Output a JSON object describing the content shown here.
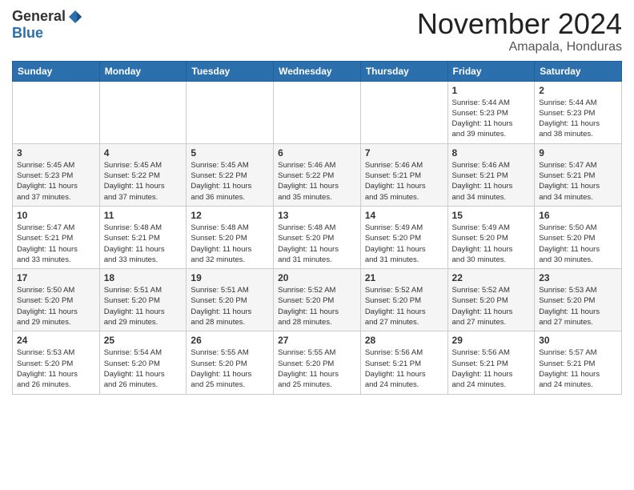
{
  "logo": {
    "general": "General",
    "blue": "Blue"
  },
  "header": {
    "month": "November 2024",
    "location": "Amapala, Honduras"
  },
  "weekdays": [
    "Sunday",
    "Monday",
    "Tuesday",
    "Wednesday",
    "Thursday",
    "Friday",
    "Saturday"
  ],
  "weeks": [
    [
      {
        "day": "",
        "info": ""
      },
      {
        "day": "",
        "info": ""
      },
      {
        "day": "",
        "info": ""
      },
      {
        "day": "",
        "info": ""
      },
      {
        "day": "",
        "info": ""
      },
      {
        "day": "1",
        "info": "Sunrise: 5:44 AM\nSunset: 5:23 PM\nDaylight: 11 hours\nand 39 minutes."
      },
      {
        "day": "2",
        "info": "Sunrise: 5:44 AM\nSunset: 5:23 PM\nDaylight: 11 hours\nand 38 minutes."
      }
    ],
    [
      {
        "day": "3",
        "info": "Sunrise: 5:45 AM\nSunset: 5:23 PM\nDaylight: 11 hours\nand 37 minutes."
      },
      {
        "day": "4",
        "info": "Sunrise: 5:45 AM\nSunset: 5:22 PM\nDaylight: 11 hours\nand 37 minutes."
      },
      {
        "day": "5",
        "info": "Sunrise: 5:45 AM\nSunset: 5:22 PM\nDaylight: 11 hours\nand 36 minutes."
      },
      {
        "day": "6",
        "info": "Sunrise: 5:46 AM\nSunset: 5:22 PM\nDaylight: 11 hours\nand 35 minutes."
      },
      {
        "day": "7",
        "info": "Sunrise: 5:46 AM\nSunset: 5:21 PM\nDaylight: 11 hours\nand 35 minutes."
      },
      {
        "day": "8",
        "info": "Sunrise: 5:46 AM\nSunset: 5:21 PM\nDaylight: 11 hours\nand 34 minutes."
      },
      {
        "day": "9",
        "info": "Sunrise: 5:47 AM\nSunset: 5:21 PM\nDaylight: 11 hours\nand 34 minutes."
      }
    ],
    [
      {
        "day": "10",
        "info": "Sunrise: 5:47 AM\nSunset: 5:21 PM\nDaylight: 11 hours\nand 33 minutes."
      },
      {
        "day": "11",
        "info": "Sunrise: 5:48 AM\nSunset: 5:21 PM\nDaylight: 11 hours\nand 33 minutes."
      },
      {
        "day": "12",
        "info": "Sunrise: 5:48 AM\nSunset: 5:20 PM\nDaylight: 11 hours\nand 32 minutes."
      },
      {
        "day": "13",
        "info": "Sunrise: 5:48 AM\nSunset: 5:20 PM\nDaylight: 11 hours\nand 31 minutes."
      },
      {
        "day": "14",
        "info": "Sunrise: 5:49 AM\nSunset: 5:20 PM\nDaylight: 11 hours\nand 31 minutes."
      },
      {
        "day": "15",
        "info": "Sunrise: 5:49 AM\nSunset: 5:20 PM\nDaylight: 11 hours\nand 30 minutes."
      },
      {
        "day": "16",
        "info": "Sunrise: 5:50 AM\nSunset: 5:20 PM\nDaylight: 11 hours\nand 30 minutes."
      }
    ],
    [
      {
        "day": "17",
        "info": "Sunrise: 5:50 AM\nSunset: 5:20 PM\nDaylight: 11 hours\nand 29 minutes."
      },
      {
        "day": "18",
        "info": "Sunrise: 5:51 AM\nSunset: 5:20 PM\nDaylight: 11 hours\nand 29 minutes."
      },
      {
        "day": "19",
        "info": "Sunrise: 5:51 AM\nSunset: 5:20 PM\nDaylight: 11 hours\nand 28 minutes."
      },
      {
        "day": "20",
        "info": "Sunrise: 5:52 AM\nSunset: 5:20 PM\nDaylight: 11 hours\nand 28 minutes."
      },
      {
        "day": "21",
        "info": "Sunrise: 5:52 AM\nSunset: 5:20 PM\nDaylight: 11 hours\nand 27 minutes."
      },
      {
        "day": "22",
        "info": "Sunrise: 5:52 AM\nSunset: 5:20 PM\nDaylight: 11 hours\nand 27 minutes."
      },
      {
        "day": "23",
        "info": "Sunrise: 5:53 AM\nSunset: 5:20 PM\nDaylight: 11 hours\nand 27 minutes."
      }
    ],
    [
      {
        "day": "24",
        "info": "Sunrise: 5:53 AM\nSunset: 5:20 PM\nDaylight: 11 hours\nand 26 minutes."
      },
      {
        "day": "25",
        "info": "Sunrise: 5:54 AM\nSunset: 5:20 PM\nDaylight: 11 hours\nand 26 minutes."
      },
      {
        "day": "26",
        "info": "Sunrise: 5:55 AM\nSunset: 5:20 PM\nDaylight: 11 hours\nand 25 minutes."
      },
      {
        "day": "27",
        "info": "Sunrise: 5:55 AM\nSunset: 5:20 PM\nDaylight: 11 hours\nand 25 minutes."
      },
      {
        "day": "28",
        "info": "Sunrise: 5:56 AM\nSunset: 5:21 PM\nDaylight: 11 hours\nand 24 minutes."
      },
      {
        "day": "29",
        "info": "Sunrise: 5:56 AM\nSunset: 5:21 PM\nDaylight: 11 hours\nand 24 minutes."
      },
      {
        "day": "30",
        "info": "Sunrise: 5:57 AM\nSunset: 5:21 PM\nDaylight: 11 hours\nand 24 minutes."
      }
    ]
  ]
}
